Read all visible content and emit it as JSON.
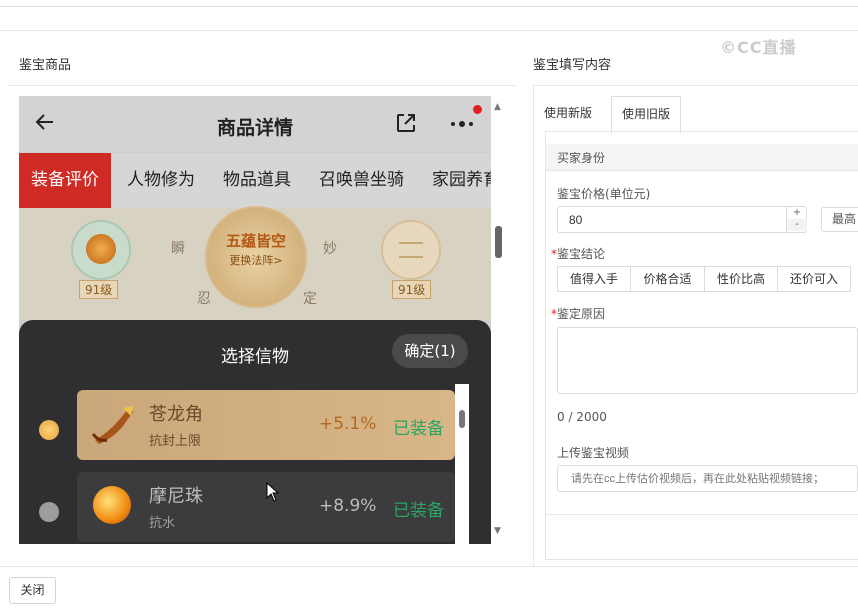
{
  "left_section_title": "鉴宝商品",
  "right_section_title": "鉴宝填写内容",
  "brand_logo_text": "©CC直播",
  "phone": {
    "title": "商品详情",
    "tabs": [
      "装备评价",
      "人物修为",
      "物品道具",
      "召唤兽坐骑",
      "家园养育"
    ],
    "level_left": "91级",
    "level_right": "91级",
    "center_title": "五蕴皆空",
    "center_sub": "更换法阵>",
    "runes": [
      "瞬",
      "妙",
      "忍",
      "定"
    ],
    "sheet_title": "选择信物",
    "confirm_label": "确定(1)",
    "items": [
      {
        "name": "苍龙角",
        "desc": "抗封上限",
        "pct": "+5.1%",
        "status": "已装备",
        "selected": true
      },
      {
        "name": "摩尼珠",
        "desc": "抗水",
        "pct": "+8.9%",
        "status": "已装备",
        "selected": false
      }
    ]
  },
  "form": {
    "tabs": [
      "使用新版",
      "使用旧版"
    ],
    "active_tab": "使用旧版",
    "buyer_identity_label": "买家身份",
    "price_label": "鉴宝价格(单位元)",
    "price_value": "80",
    "max_label": "最高",
    "conclusion_label": "鉴宝结论",
    "conclusion_options": [
      "值得入手",
      "价格合适",
      "性价比高",
      "还价可入"
    ],
    "reason_label": "鉴定原因",
    "reason_counter": "0 / 2000",
    "video_label": "上传鉴宝视频",
    "video_placeholder": "请先在cc上传估价视频后，再在此处粘贴视频链接；"
  },
  "footer": {
    "close_label": "关闭"
  },
  "colors": {
    "accent_red": "#cf2a23",
    "equipped_green": "#2aa563"
  }
}
